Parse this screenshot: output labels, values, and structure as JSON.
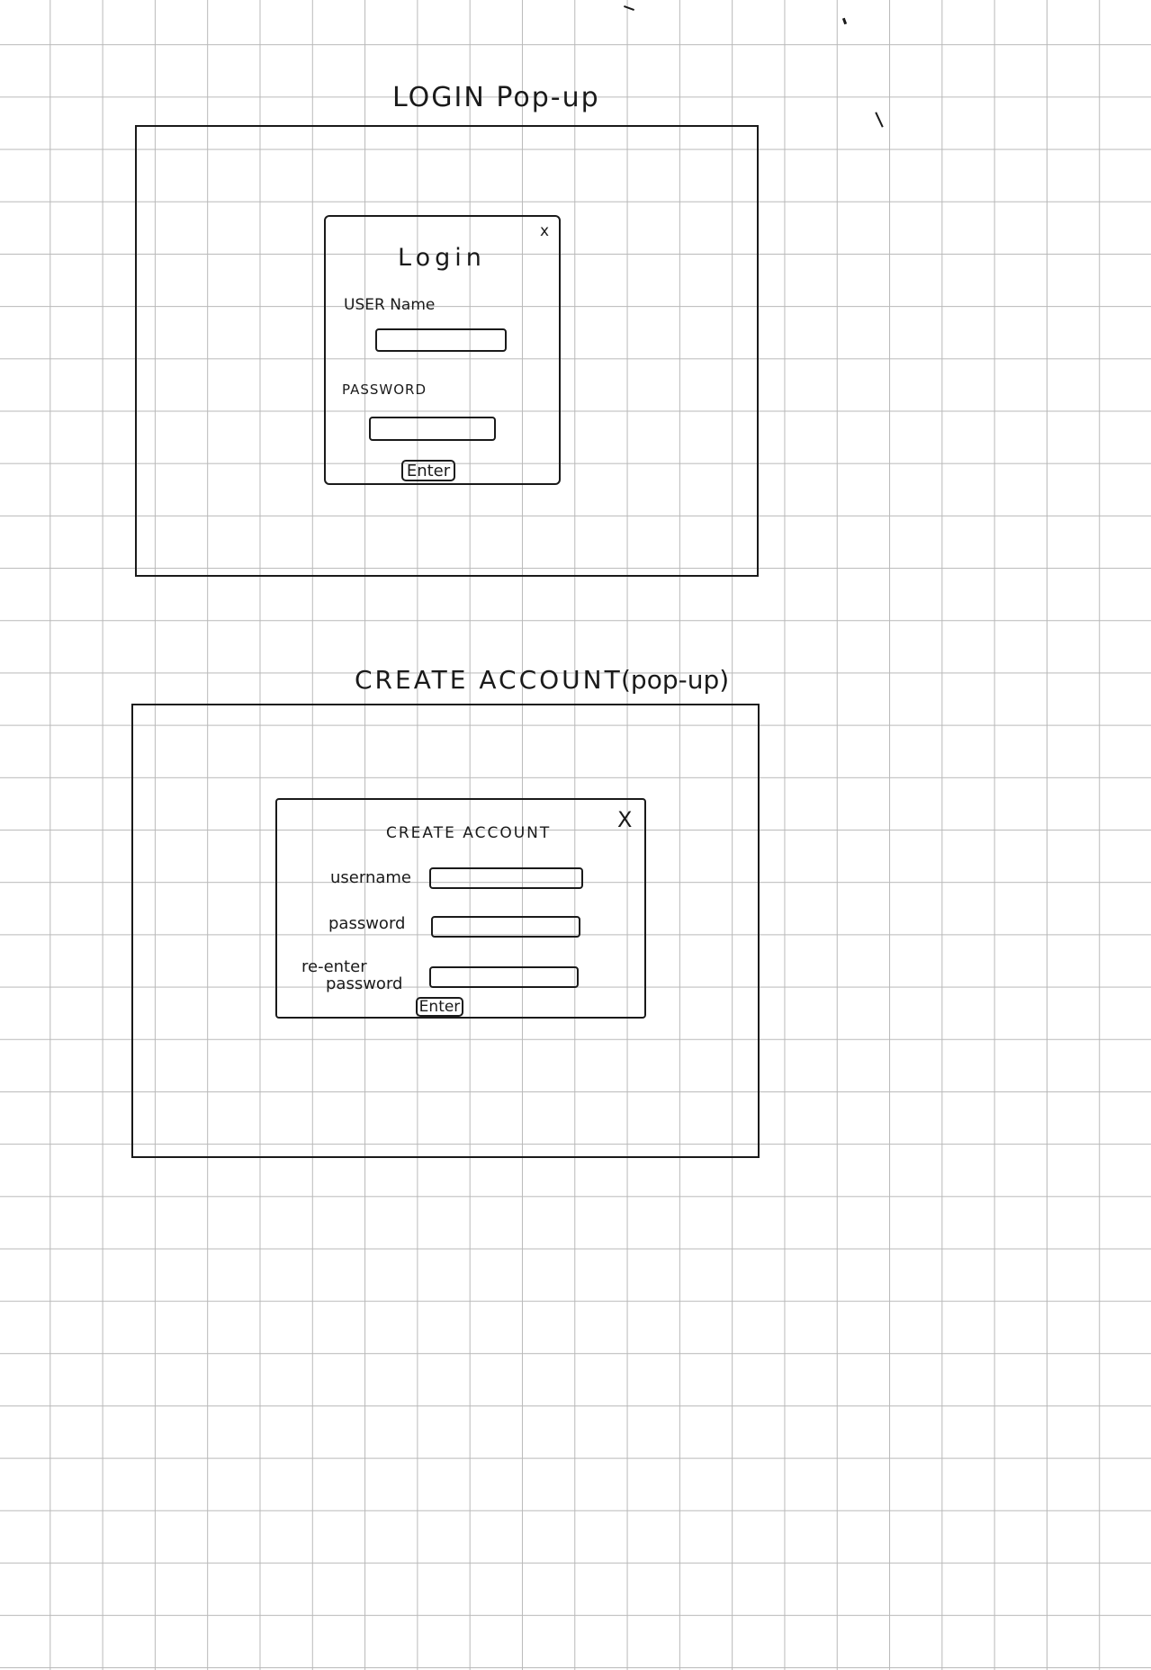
{
  "login_section": {
    "heading": "LOGIN  Pop-up",
    "dialog": {
      "title": "Login",
      "close_label": "x",
      "username_label": "USER Name",
      "password_label": "PASSWORD",
      "username_value": "",
      "password_value": "",
      "enter_label": "Enter"
    }
  },
  "create_section": {
    "heading": "CREATE  ACCOUNT",
    "heading_suffix": "(pop-up)",
    "dialog": {
      "title": "CREATE  ACCOUNT",
      "close_label": "X",
      "username_label": "username",
      "password_label": "password",
      "reenter_label_line1": "re-enter",
      "reenter_label_line2": "password",
      "username_value": "",
      "password_value": "",
      "reenter_value": "",
      "enter_label": "Enter"
    }
  }
}
